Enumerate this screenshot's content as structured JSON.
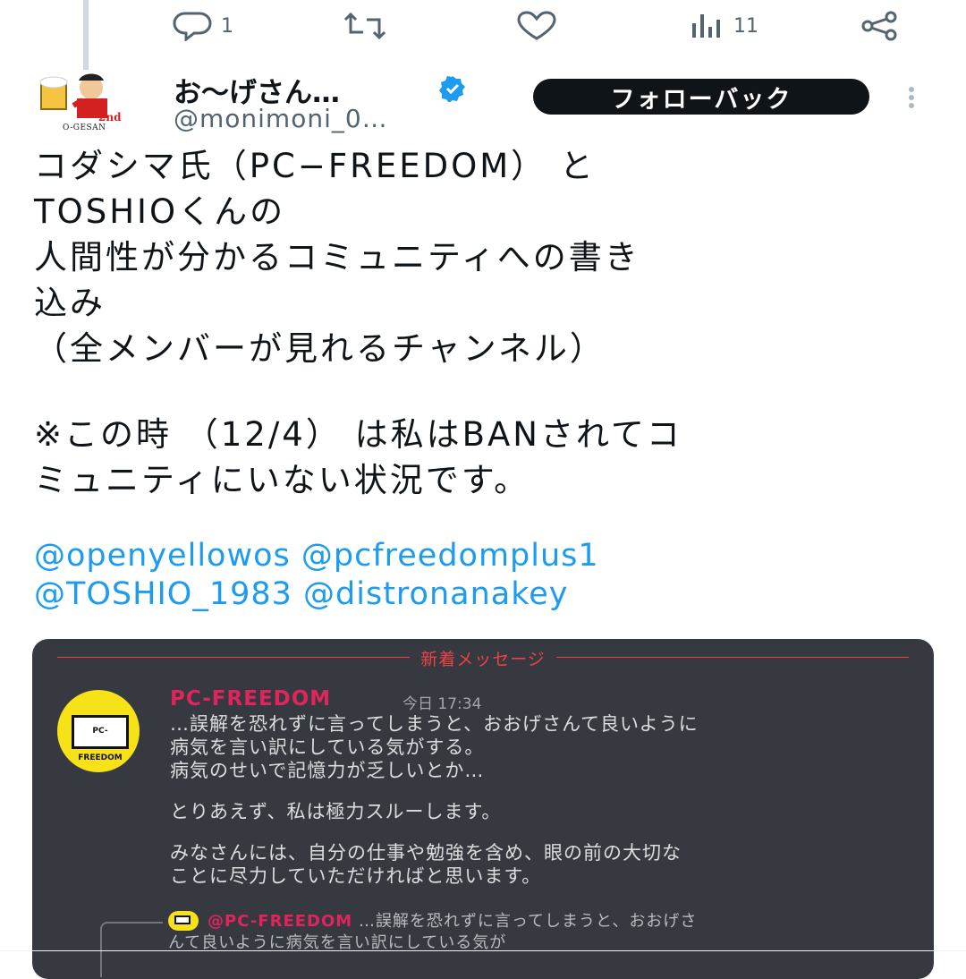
{
  "actions": {
    "reply_count": "1",
    "retweet_count": "",
    "like_count": "",
    "views_count": "11"
  },
  "author": {
    "name": "お〜げさん…",
    "handle": "@monimoni_0…",
    "avatar_text": "O-GESAN",
    "avatar_badge": "2nd",
    "verified": true
  },
  "follow_button_label": "フォローバック",
  "tweet": {
    "lines": [
      "コダシマ氏（PC−FREEDOM） と",
      "TOSHIOくんの",
      "人間性が分かるコミュニティへの書き",
      "込み",
      "（全メンバーが見れるチャンネル）"
    ],
    "note_lines": [
      "※この時 （12/4） は私はBANされてコ",
      "ミュニティにいない状況です。"
    ],
    "mentions": [
      "@openyellowos @pcfreedomplus1",
      "@TOSHIO_1983 @distronanakey"
    ]
  },
  "embed": {
    "divider_label": "新着メッセージ",
    "avatar_text": "PC-FREEDOM",
    "author": "PC-FREEDOM",
    "time": "今日 17:34",
    "message_lines": [
      "…誤解を恐れずに言ってしまうと、おおげさんて良いように",
      "病気を言い訳にしている気がする。",
      "病気のせいで記憶力が乏しいとか…",
      "",
      "とりあえず、私は極力スルーします。",
      "",
      "みなさんには、自分の仕事や勉強を含め、眼の前の大切な",
      "ことに尽力していただければと思います。"
    ],
    "reply_author": "@PC-FREEDOM",
    "reply_lines": [
      "…誤解を恐れずに言ってしまうと、おおげさ",
      "んて良いように病気を言い訳にしている気が"
    ]
  },
  "colors": {
    "link": "#1d9bf0",
    "verified": "#1d9bf0",
    "embed_bg": "#36393f",
    "accent_red": "#ed4245"
  }
}
